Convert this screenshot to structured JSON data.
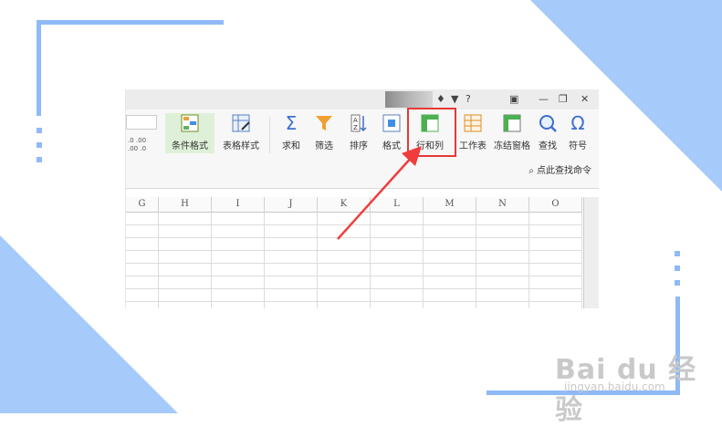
{
  "title_bar": {
    "help_label": "?",
    "minimize_label": "—",
    "close_label": "✕"
  },
  "ribbon": {
    "buttons": [
      {
        "label": "条件格式"
      },
      {
        "label": "表格样式"
      },
      {
        "label": "求和"
      },
      {
        "label": "筛选"
      },
      {
        "label": "排序"
      },
      {
        "label": "格式"
      },
      {
        "label": "行和列"
      },
      {
        "label": "工作表"
      },
      {
        "label": "冻结窗格"
      },
      {
        "label": "查找"
      },
      {
        "label": "符号"
      }
    ],
    "find_command_label": "点此查找命令",
    "number_format_top": ".0 .00",
    "number_format_bottom": ".00 .0"
  },
  "sheet": {
    "columns": [
      "G",
      "H",
      "I",
      "J",
      "K",
      "L",
      "M",
      "N",
      "O"
    ]
  },
  "watermark": {
    "brand": "Bai du 经验",
    "url": "jingyan.baidu.com"
  },
  "colors": {
    "accent_blue": "#a6cbfb",
    "highlight_red": "#e53935",
    "arrow_red": "#f03c3c"
  }
}
